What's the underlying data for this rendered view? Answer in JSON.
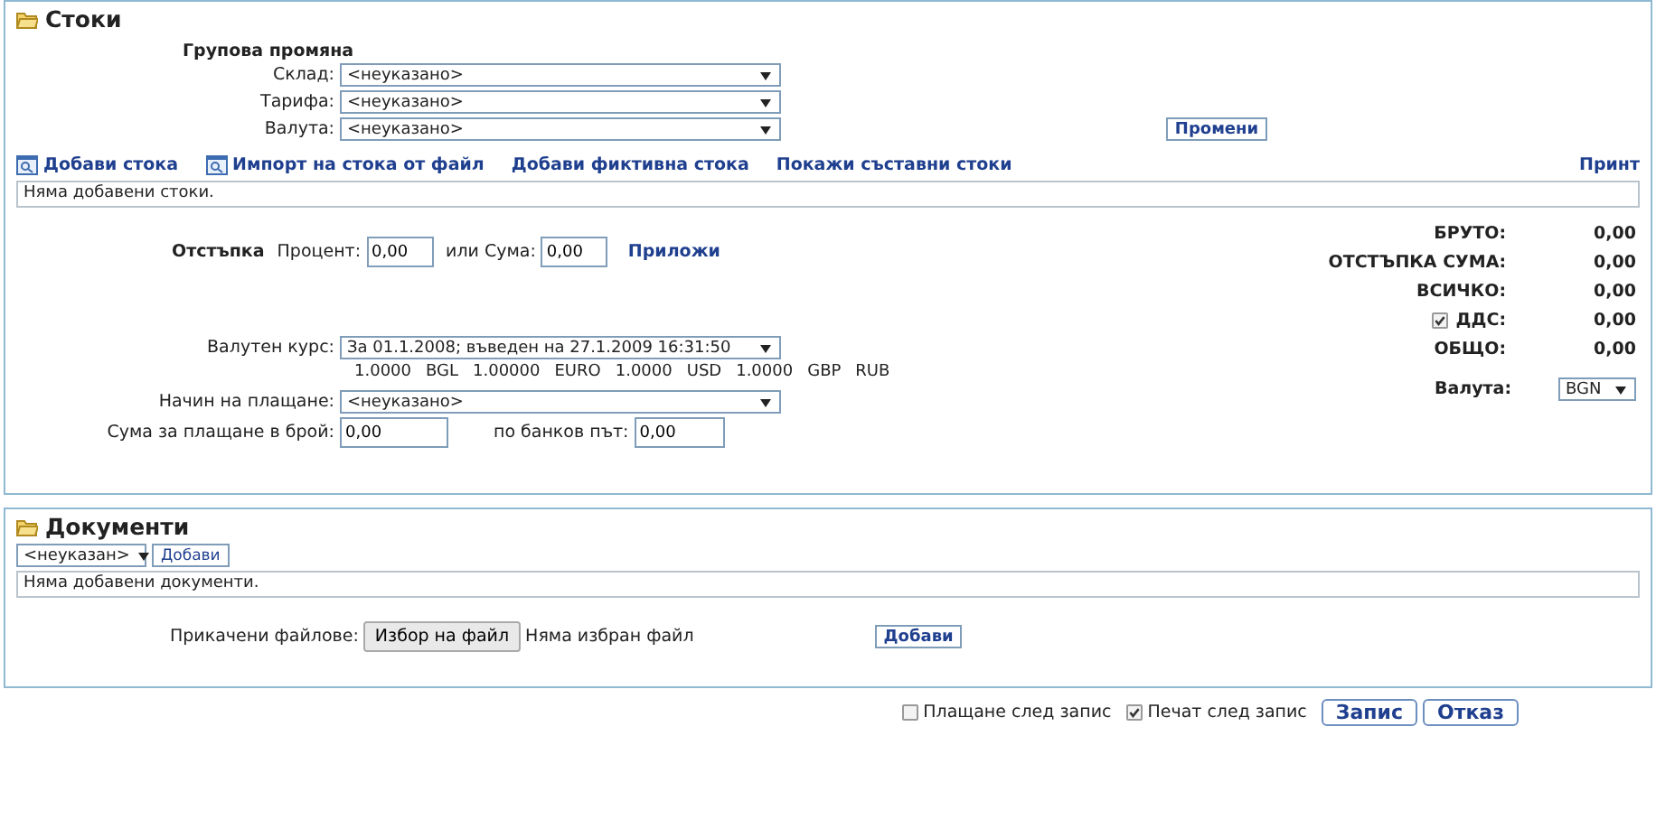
{
  "stock_panel": {
    "title": "Стоки",
    "group_change": {
      "heading": "Групова промяна",
      "fields": [
        {
          "label": "Склад:",
          "value": "<неуказано>"
        },
        {
          "label": "Тарифа:",
          "value": "<неуказано>"
        },
        {
          "label": "Валута:",
          "value": "<неуказано>"
        }
      ],
      "apply_button": "Промени"
    },
    "actions": [
      {
        "label": "Добави стока",
        "kind": "icon-link"
      },
      {
        "label": "Импорт на стока от файл",
        "kind": "icon-link"
      },
      {
        "label": "Добави фиктивна стока",
        "kind": "link"
      },
      {
        "label": "Покажи съставни стоки",
        "kind": "link"
      }
    ],
    "print_link": "Принт",
    "empty_message": "Няма добавени стоки.",
    "discount": {
      "label": "Отстъпка",
      "percent_label": "Процент:",
      "percent_value": "0,00",
      "amount_label": "или Сума:",
      "amount_value": "0,00",
      "apply_link": "Приложи"
    },
    "exchange_rate": {
      "label": "Валутен курс:",
      "value": "За 01.1.2008; въведен на 27.1.2009 16:31:50",
      "rates": [
        "1.0000",
        "BGL",
        "1.00000",
        "EURO",
        "1.0000",
        "USD",
        "1.0000",
        "GBP",
        "RUB"
      ]
    },
    "payment_method": {
      "label": "Начин на плащане:",
      "value": "<неуказано>"
    },
    "cash": {
      "label": "Сума за плащане в брой:",
      "value": "0,00"
    },
    "bank": {
      "label": "по банков път:",
      "value": "0,00"
    },
    "totals": [
      {
        "label": "БРУТО:",
        "value": "0,00",
        "kind": "plain"
      },
      {
        "label": "ОТСТЪПКА СУМА:",
        "value": "0,00",
        "kind": "plain"
      },
      {
        "label": "ВСИЧКО:",
        "value": "0,00",
        "kind": "plain"
      },
      {
        "label": "ДДС:",
        "value": "0,00",
        "kind": "checkbox",
        "checked": true
      },
      {
        "label": "ОБЩО:",
        "value": "0,00",
        "kind": "plain"
      }
    ],
    "currency": {
      "label": "Валута:",
      "value": "BGN"
    }
  },
  "documents_panel": {
    "title": "Документи",
    "type_value": "<неуказан>",
    "add_button": "Добави",
    "empty_message": "Няма добавени документи.",
    "attach_label": "Прикачени файлове:",
    "file_button": "Избор на файл",
    "file_status": "Няма избран файл",
    "upload_button": "Добави"
  },
  "footer": {
    "options": [
      {
        "label": "Плащане след запис",
        "checked": false
      },
      {
        "label": "Печат след запис",
        "checked": true
      }
    ],
    "buttons": [
      "Запис",
      "Отказ"
    ]
  }
}
